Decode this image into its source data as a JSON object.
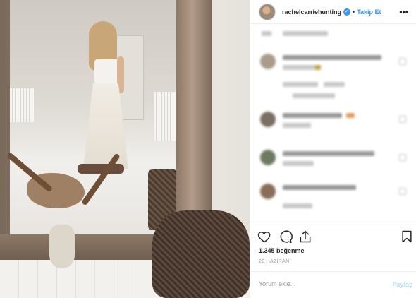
{
  "post": {
    "image_alt": "",
    "photo_colors": {
      "frame": "#8d7866",
      "wall": "#ece9e4",
      "basket": "#4b3a2e"
    }
  },
  "header": {
    "username": "rachelcarriehunting",
    "verified_icon": "verified-badge-icon",
    "separator": "•",
    "follow_label": "Takip Et",
    "more_icon": "more-options-icon"
  },
  "comments_blurred": true,
  "actions": {
    "like_icon": "heart-icon",
    "comment_icon": "comment-bubble-icon",
    "share_icon": "share-icon",
    "save_icon": "bookmark-icon"
  },
  "likes_text": "1.345 beğenme",
  "date_text": "20 HAZİRAN",
  "comment_form": {
    "placeholder": "Yorum ekle...",
    "post_label": "Paylaş"
  },
  "colors": {
    "accent": "#3897f0",
    "post_disabled": "#b2dffc",
    "text": "#262626",
    "muted": "#999999",
    "divider": "#efefef"
  }
}
